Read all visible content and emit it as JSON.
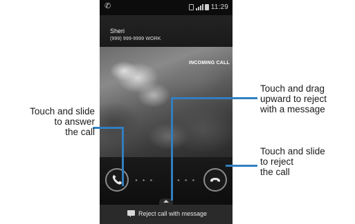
{
  "status_bar": {
    "time": "11:29",
    "icons": [
      "call-icon",
      "sim-icon",
      "signal-icon",
      "battery-icon"
    ]
  },
  "caller": {
    "name": "Sheri",
    "number": "(999) 999-9999 WORK"
  },
  "incoming_label": "INCOMING CALL",
  "controls": {
    "answer_icon": "phone-answer-icon",
    "reject_icon": "phone-reject-icon",
    "right_arrows": "▸ ▸ ▸",
    "left_arrows": "◂ ◂ ◂"
  },
  "reject_message_bar": {
    "label": "Reject call with message",
    "icon": "message-icon"
  },
  "annotations": {
    "answer": [
      "Touch and slide",
      "to answer",
      "the call"
    ],
    "reject_message": [
      "Touch and drag",
      "upward to reject",
      "with a message"
    ],
    "reject": [
      "Touch and slide",
      "to reject",
      "the call"
    ]
  },
  "colors": {
    "callout_line": "#2f7fc1",
    "screen_background": "#000000"
  }
}
